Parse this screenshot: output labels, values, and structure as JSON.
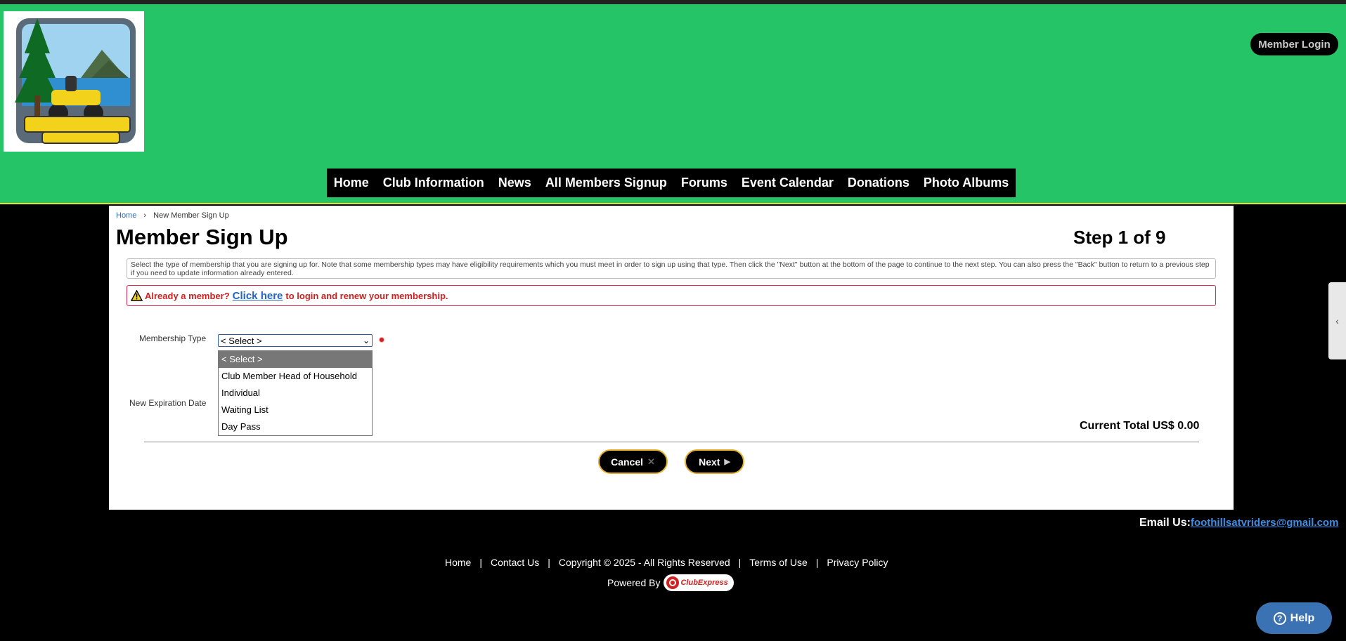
{
  "header": {
    "login_label": "Member Login"
  },
  "nav": {
    "items": [
      {
        "label": "Home"
      },
      {
        "label": "Club Information"
      },
      {
        "label": "News"
      },
      {
        "label": "All Members Signup"
      },
      {
        "label": "Forums"
      },
      {
        "label": "Event Calendar"
      },
      {
        "label": "Donations"
      },
      {
        "label": "Photo Albums"
      }
    ]
  },
  "breadcrumb": {
    "home": "Home",
    "separator": "›",
    "current": "New Member Sign Up"
  },
  "page": {
    "title": "Member Sign Up",
    "step": "Step 1 of 9",
    "info_text": "Select the type of membership that you are signing up for. Note that some membership types may have eligibility requirements which you must meet in order to sign up using that type. Then click the \"Next\" button at the bottom of the page to continue to the next step. You can also press the \"Back\" button to return to a previous step if you need to update information already entered.",
    "warn_prefix": "Already a member?",
    "warn_link": "Click here",
    "warn_suffix": "to login and renew your membership."
  },
  "form": {
    "membership_type_label": "Membership Type",
    "expiration_label": "New Expiration Date",
    "selected_value": "< Select >",
    "options": [
      {
        "label": "< Select >"
      },
      {
        "label": "Club Member Head of Household"
      },
      {
        "label": "Individual"
      },
      {
        "label": "Waiting List"
      },
      {
        "label": "Day Pass"
      }
    ],
    "total_label": "Current Total US$ 0.00"
  },
  "buttons": {
    "cancel": "Cancel",
    "next": "Next"
  },
  "footer": {
    "email_label": "Email Us:",
    "email_address": "foothillsatvriders@gmail.com",
    "links": [
      {
        "label": "Home"
      },
      {
        "label": "Contact Us"
      },
      {
        "label": "Copyright © 2025 - All Rights Reserved"
      },
      {
        "label": "Terms of Use"
      },
      {
        "label": "Privacy Policy"
      }
    ],
    "link_separator": "|",
    "powered_by": "Powered By",
    "brand": "ClubExpress"
  },
  "help": {
    "label": "Help"
  },
  "colors": {
    "header_green": "#25c466",
    "accent_yellow": "#e8b02a",
    "warn_red": "#d21f1f",
    "link_blue": "#2a6ebb",
    "help_blue": "#3b72b3"
  }
}
